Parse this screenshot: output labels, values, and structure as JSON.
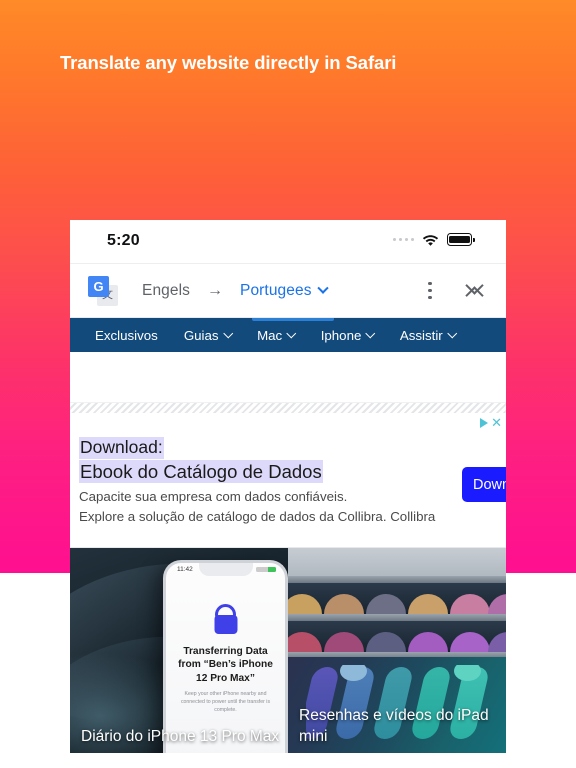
{
  "headline": "Translate any website directly in Safari",
  "background": {
    "top_color": "#ff8a28",
    "bottom_color": "#ff0f90"
  },
  "phone": {
    "status_bar": {
      "time": "5:20",
      "signal_icon": "signal-dots-icon",
      "wifi_icon": "wifi-icon",
      "battery_icon": "battery-icon"
    },
    "translate_bar": {
      "app_icon": "google-translate-icon",
      "app_icon_letter": "G",
      "app_icon_glyph": "文",
      "source_language": "Engels",
      "arrow": "→",
      "target_language": "Portugees",
      "target_dropdown_icon": "chevron-down-icon",
      "more_icon": "kebab-menu-icon",
      "collapse_icon": "collapse-chevrons-icon"
    },
    "site_nav": {
      "background_color": "#134a7c",
      "highlight_color": "#2b7fd4",
      "items": [
        {
          "label": "Exclusivos",
          "has_dropdown": false
        },
        {
          "label": "Guias",
          "has_dropdown": true
        },
        {
          "label": "Mac",
          "has_dropdown": true,
          "active": true
        },
        {
          "label": "Iphone",
          "has_dropdown": true
        },
        {
          "label": "Assistir",
          "has_dropdown": true
        }
      ]
    },
    "ad": {
      "adchoices_icon": "adchoices-triangle-icon",
      "close_icon": "close-x-icon",
      "headline_line1": "Download:",
      "headline_line2": "Ebook do Catálogo de Dados",
      "body_line1": "Capacite sua empresa com dados confiáveis.",
      "body_line2": "Explore a solução de catálogo de dados da Collibra. Collibra",
      "cta_label": "Download",
      "cta_color": "#1b1bff",
      "highlight_color": "#ddd9fb"
    },
    "stories": [
      {
        "caption": "Diário do iPhone 13 Pro Max",
        "inner_phone": {
          "time": "11:42",
          "lock_icon": "lock-icon",
          "title": "Transferring Data from “Ben’s iPhone 12 Pro Max”",
          "subtitle": "Keep your other iPhone nearby and connected to power until the transfer is complete."
        }
      },
      {
        "caption": "Resenhas e vídeos do iPad mini",
        "word_mark": "mini"
      }
    ]
  }
}
